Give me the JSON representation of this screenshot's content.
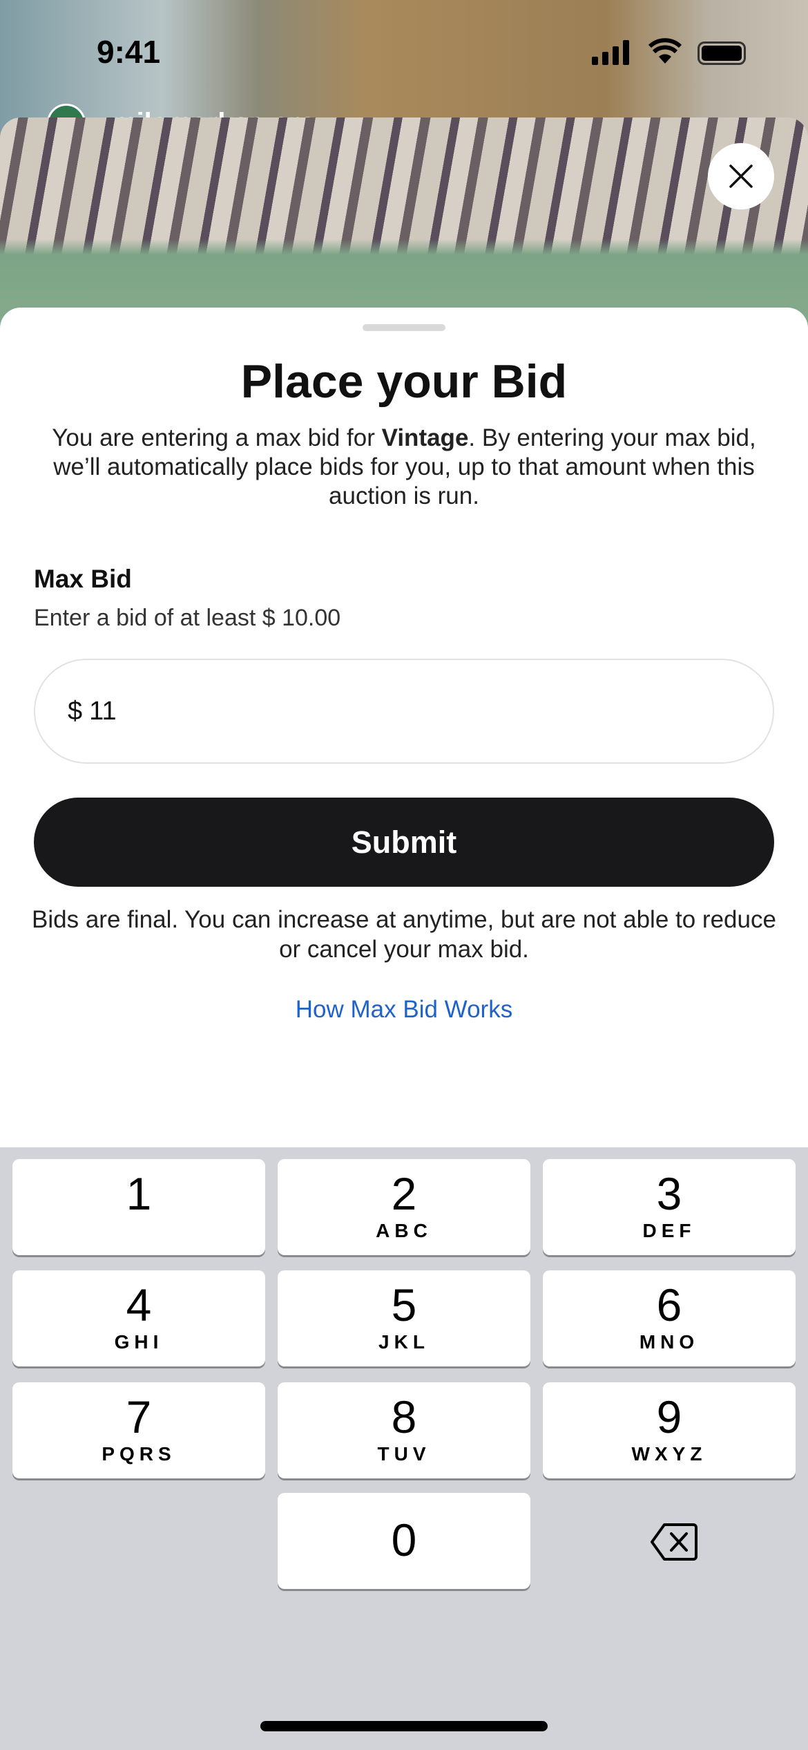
{
  "status_bar": {
    "time": "9:41"
  },
  "stream": {
    "host": "milemarkerzero"
  },
  "sheet": {
    "title": "Place your Bid",
    "description_prefix": "You are entering a max bid for ",
    "item_name": "Vintage",
    "description_suffix": ". By entering your max bid, we’ll automatically place bids for you, up to that amount when this auction is run.",
    "max_bid_label": "Max Bid",
    "min_bid_hint": "Enter a bid of at least $ 10.00",
    "currency_symbol": "$",
    "bid_value": "11",
    "submit_label": "Submit",
    "disclaimer": "Bids are final. You can increase at anytime, but are not able to reduce or cancel your max bid.",
    "help_link": "How Max Bid Works",
    "link_color": "#1f62c9"
  },
  "keypad": {
    "keys": [
      {
        "num": "1",
        "letters": ""
      },
      {
        "num": "2",
        "letters": "ABC"
      },
      {
        "num": "3",
        "letters": "DEF"
      },
      {
        "num": "4",
        "letters": "GHI"
      },
      {
        "num": "5",
        "letters": "JKL"
      },
      {
        "num": "6",
        "letters": "MNO"
      },
      {
        "num": "7",
        "letters": "PQRS"
      },
      {
        "num": "8",
        "letters": "TUV"
      },
      {
        "num": "9",
        "letters": "WXYZ"
      },
      {
        "num": "0",
        "letters": ""
      }
    ],
    "delete_icon": "backspace-icon"
  }
}
